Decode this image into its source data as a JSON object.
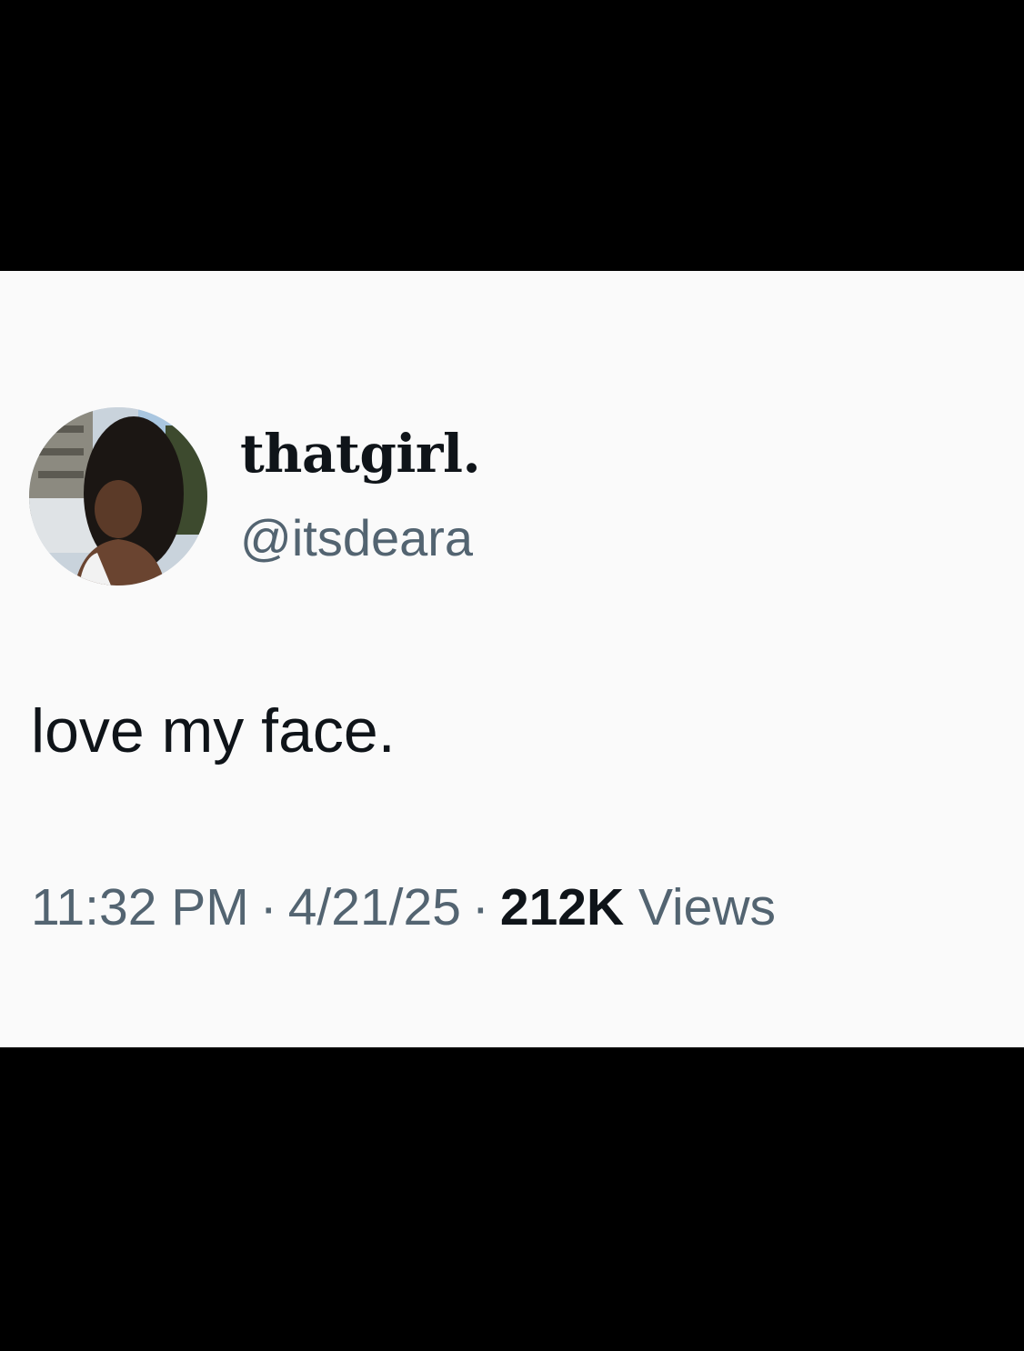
{
  "tweet": {
    "display_name": "thatgirl.",
    "handle": "@itsdeara",
    "text": "love my face.",
    "time": "11:32 PM",
    "date": "4/21/25",
    "separator": "·",
    "views_count": "212K",
    "views_label": "Views"
  },
  "colors": {
    "background_bars": "#000000",
    "card": "#fafafa",
    "primary_text": "#0f1419",
    "secondary_text": "#536471"
  }
}
